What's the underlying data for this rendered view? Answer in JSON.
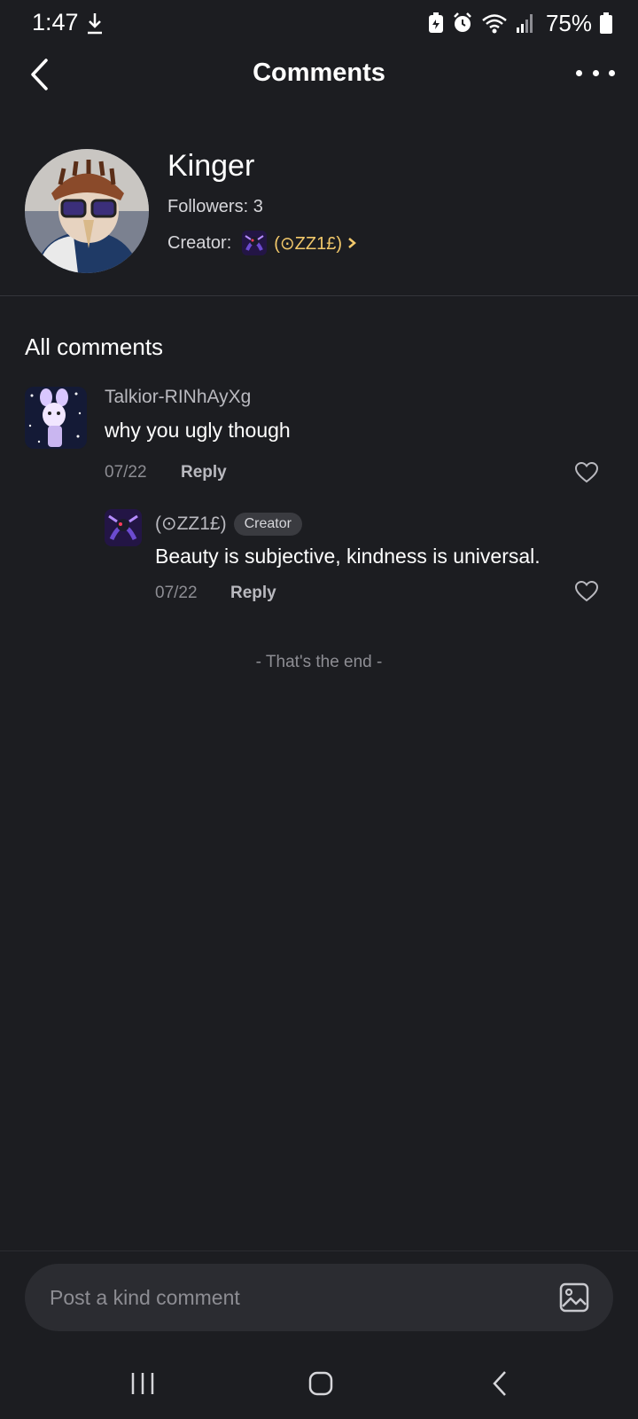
{
  "status": {
    "time": "1:47",
    "battery": "75%"
  },
  "header": {
    "title": "Comments"
  },
  "profile": {
    "name": "Kinger",
    "followers": "Followers: 3",
    "creator_label": "Creator:",
    "creator_name": "(⊙ZZ1£)"
  },
  "comments": {
    "section_title": "All comments",
    "items": [
      {
        "user": "Talkior-RINhAyXg",
        "text": "why you ugly though",
        "date": "07/22",
        "reply_label": "Reply"
      },
      {
        "user": "(⊙ZZ1£)",
        "badge": "Creator",
        "text": "Beauty is subjective, kindness is universal.",
        "date": "07/22",
        "reply_label": "Reply"
      }
    ],
    "end_text": "- That's the end -"
  },
  "input": {
    "placeholder": "Post a kind comment"
  },
  "colors": {
    "background": "#1c1d21",
    "creator_link": "#f3c96b",
    "input_bg": "#2b2c31"
  },
  "icons": [
    "download-icon",
    "battery-saver-icon",
    "alarm-icon",
    "wifi-icon",
    "signal-icon",
    "battery-icon",
    "back-arrow-icon",
    "more-icon",
    "chevron-right-icon",
    "heart-icon",
    "image-icon",
    "recent-apps-icon",
    "home-icon",
    "nav-back-icon"
  ]
}
